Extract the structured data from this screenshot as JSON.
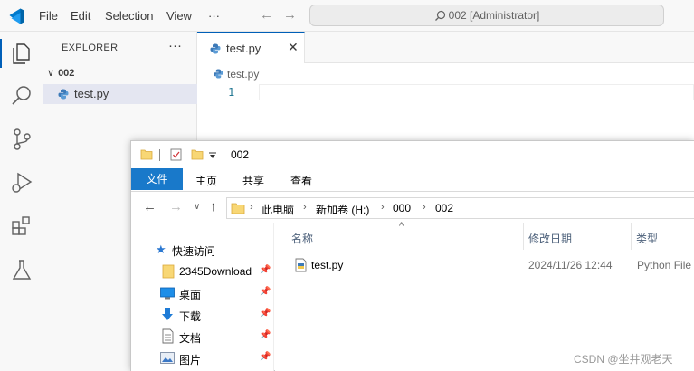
{
  "vscode": {
    "menu": [
      "File",
      "Edit",
      "Selection",
      "View"
    ],
    "more": "···",
    "back_arrow": "←",
    "forward_arrow": "→",
    "search_text": "002 [Administrator]",
    "activity_icons": [
      "files-icon",
      "search-icon",
      "source-control-icon",
      "run-debug-icon",
      "extensions-icon",
      "testing-icon"
    ],
    "explorer": {
      "title": "EXPLORER",
      "more": "···",
      "folder_chevron": "∨",
      "folder": "002",
      "file": "test.py"
    },
    "editor": {
      "tab_label": "test.py",
      "tab_close": "✕",
      "breadcrumb": "test.py",
      "line_number": "1"
    },
    "colors": {
      "accent": "#005fb8",
      "selected_file_bg": "#e4e6f1",
      "python_icon": "#3d7ab8"
    }
  },
  "file_explorer": {
    "title": "002",
    "ribbon_tabs": [
      "文件",
      "主页",
      "共享",
      "查看"
    ],
    "nav": {
      "back": "←",
      "forward": "→",
      "dropdown": "∨",
      "up": "↑"
    },
    "address": [
      "此电脑",
      "新加卷 (H:)",
      "000",
      "002"
    ],
    "address_sep": "›",
    "sidebar": [
      {
        "label": "快速访问",
        "icon": "star-icon"
      },
      {
        "label": "2345Download",
        "icon": "folder-icon",
        "pinned": true
      },
      {
        "label": "桌面",
        "icon": "desktop-icon",
        "pinned": true
      },
      {
        "label": "下载",
        "icon": "download-icon",
        "pinned": true
      },
      {
        "label": "文档",
        "icon": "document-icon",
        "pinned": true
      },
      {
        "label": "图片",
        "icon": "picture-icon",
        "pinned": true
      }
    ],
    "pin_glyph": "📌",
    "columns": [
      "名称",
      "修改日期",
      "类型"
    ],
    "sort_caret": "^",
    "files": [
      {
        "name": "test.py",
        "modified": "2024/11/26 12:44",
        "type": "Python File"
      }
    ],
    "colors": {
      "file_tab_bg": "#1979ca",
      "folder_yellow": "#f8d775"
    }
  },
  "watermark": "CSDN @坐井观老天"
}
